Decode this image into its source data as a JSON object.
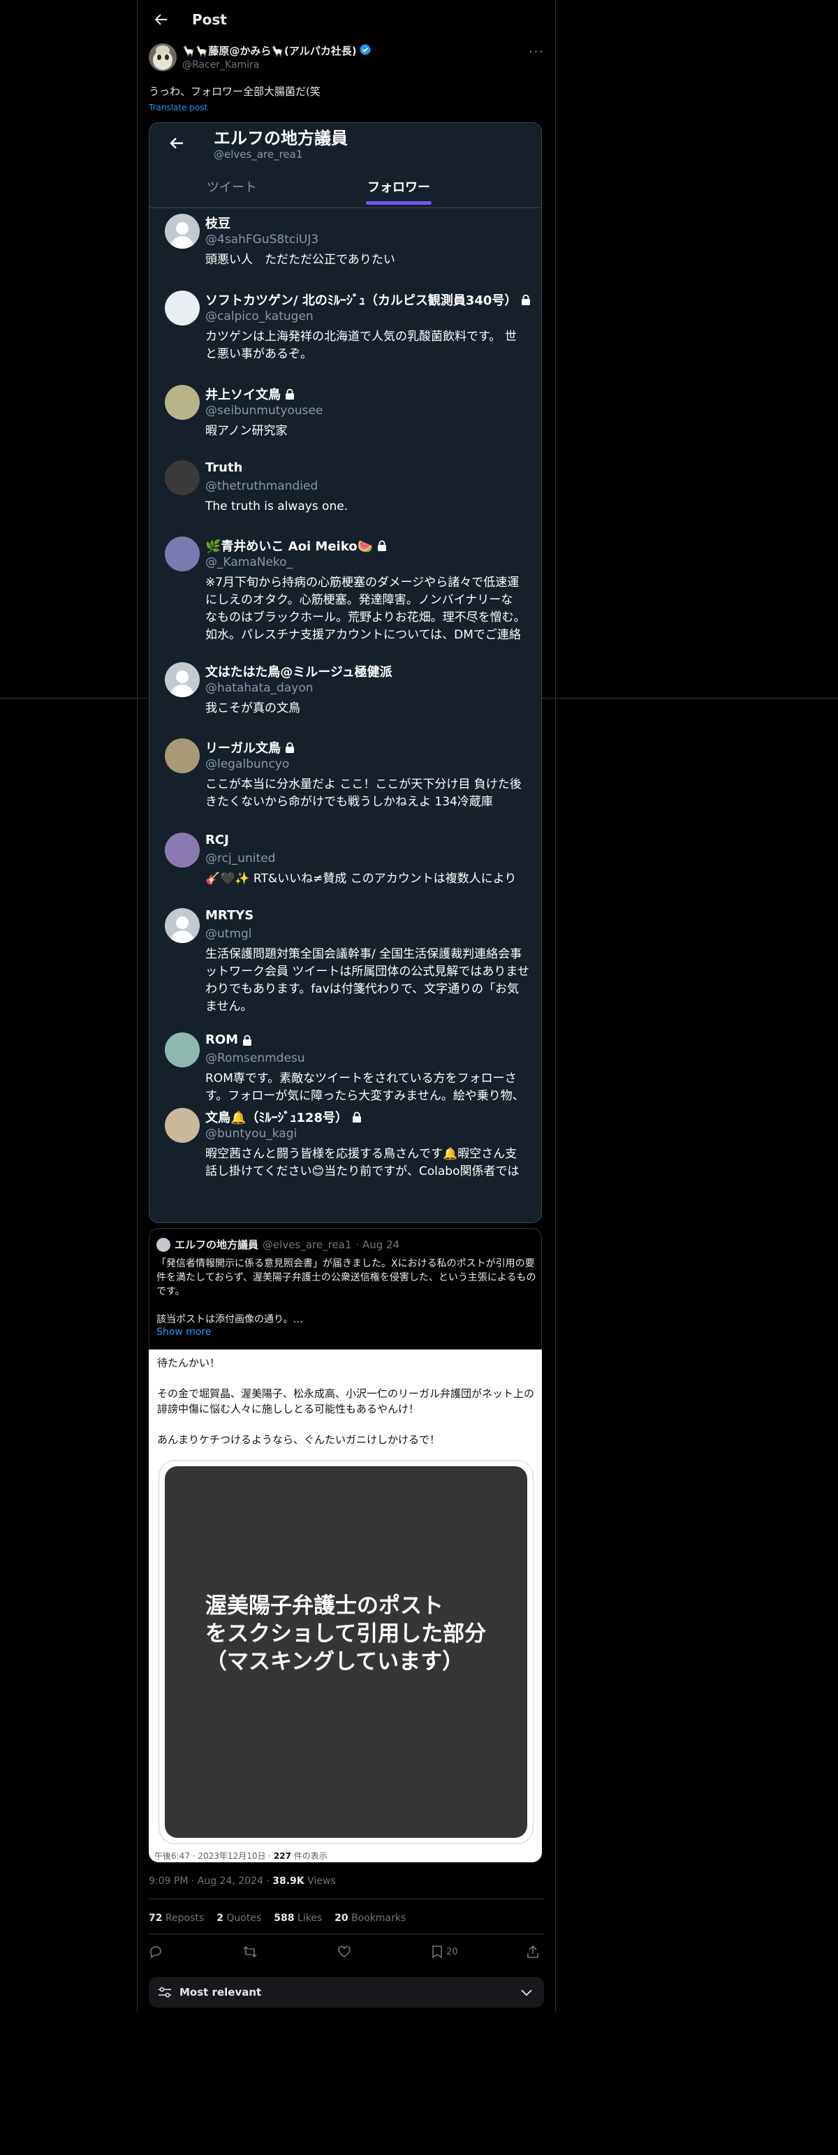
{
  "header": {
    "title": "Post"
  },
  "author": {
    "display_name": "🦙🦙藤原@かみら🦙(アルパカ社長)",
    "handle": "@Racer_Kamira"
  },
  "tweet": {
    "text": "うっわ、フォロワー全部大腸菌だ(笑",
    "translate_label": "Translate post"
  },
  "screenshot1": {
    "title": "エルフの地方議員",
    "handle": "@elves_are_rea1",
    "tabs": [
      "ツイート",
      "フォロワー"
    ],
    "users": [
      {
        "name": "枝豆",
        "handle": "@4sahFGuS8tciUJ3",
        "bio": "頭悪い人　ただただ公正でありたい",
        "locked": false,
        "avatar": "default"
      },
      {
        "name": "ソフトカツゲン/ 北のﾐﾙｰｼﾞｭ（カルピス観測員340号）",
        "handle": "@calpico_katugen",
        "bio": "カツゲンは上海発祥の北海道で人気の乳酸菌飲料です。 世\nと悪い事があるぞ。",
        "locked": true,
        "avatar": "#e8eef2"
      },
      {
        "name": "井上ソイ文鳥",
        "handle": "@seibunmutyousee",
        "bio": "暇アノン研究家",
        "locked": true,
        "avatar": "#b9b38a"
      },
      {
        "name": "Truth",
        "handle": "@thetruthmandied",
        "bio": "The truth is always one.",
        "locked": false,
        "avatar": "#3a3a3a"
      },
      {
        "name": "🌿青井めいこ Aoi Meiko🍉",
        "handle": "@_KamaNeko_",
        "bio": "※7月下旬から持病の心筋梗塞のダメージやら諸々で低速運\nにしえのオタク。心筋梗塞。発達障害。ノンバイナリーな\nなものはブラックホール。荒野よりお花畑。理不尽を憎む。\n如水。パレスチナ支援アカウントについては、DMでご連絡",
        "locked": true,
        "avatar": "#7a7ab0"
      },
      {
        "name": "文はたはた鳥@ミルージュ極健派",
        "handle": "@hatahata_dayon",
        "bio": "我こそが真の文鳥",
        "locked": false,
        "avatar": "default"
      },
      {
        "name": "リーガル文鳥",
        "handle": "@legalbuncyo",
        "bio": "ここが本当に分水量だよ ここ！ここが天下分け目 負けた後\nきたくないから命がけでも戦うしかねえよ 134冷蔵庫",
        "locked": true,
        "avatar": "#a89a78"
      },
      {
        "name": "RCJ",
        "handle": "@rcj_united",
        "bio": "🎸🖤✨ RT&いいね≠賛成 このアカウントは複数人により",
        "locked": false,
        "avatar": "#8a7ab0"
      },
      {
        "name": "MRTYS",
        "handle": "@utmgl",
        "bio": "生活保護問題対策全国会議幹事/ 全国生活保護裁判連絡会事\nットワーク会員 ツイートは所属団体の公式見解ではありませ\nわりでもあります。favは付箋代わりで、文字通りの「お気\nません。",
        "locked": false,
        "avatar": "default"
      },
      {
        "name": "ROM",
        "handle": "@Romsenmdesu",
        "bio": "ROM専です。素敵なツイートをされている方をフォローさ\nす。フォローが気に障ったら大変すみません。絵や乗り物、",
        "locked": true,
        "avatar": "#8fb8b0"
      },
      {
        "name": "文鳥🔔（ﾐﾙｰｼﾞｭ128号）",
        "handle": "@buntyou_kagi",
        "bio": "暇空茜さんと闘う皆様を応援する鳥さんです🔔暇空さん支\n話し掛けてください😊当たり前ですが、Colabo関係者では",
        "locked": true,
        "avatar": "#c9b89a"
      }
    ]
  },
  "quote": {
    "author_name": "エルフの地方議員",
    "handle": "@elves_are_rea1",
    "date": "· Aug 24",
    "text": "「発信者情報開示に係る意見照会書」が届きました。Xにおける私のポストが引用の要件を満たしておらず、渥美陽子弁護士の公衆送信権を侵害した、という主張によるものです。\n\n該当ポストは添付画像の通り。…",
    "show_more": "Show more"
  },
  "screenshot2": {
    "text": "待たんかい！\n\nその金で堀賀晶、渥美陽子、松永成高、小沢一仁のリーガル弁護団がネット上の誹謗中傷に悩む人々に施ししとる可能性もあるやんけ！\n\nあんまりケチつけるようなら、ぐんたいガニけしかけるで！",
    "image_text": "渥美陽子弁護士のポスト\nをスクショして引用した部分\n（マスキングしています）",
    "meta_date": "午後6:47 · 2023年12月10日 · ",
    "meta_views": "227",
    "meta_views_label": " 件の表示"
  },
  "timestamp": {
    "time": "9:09 PM · Aug 24, 2024 · ",
    "views": "38.9K",
    "views_label": " Views"
  },
  "stats": [
    {
      "count": "72",
      "label": " Reposts"
    },
    {
      "count": "2",
      "label": " Quotes"
    },
    {
      "count": "588",
      "label": " Likes"
    },
    {
      "count": "20",
      "label": " Bookmarks"
    }
  ],
  "actions": {
    "bookmark_count": "20"
  },
  "sort": {
    "label": "Most relevant"
  },
  "colors": {
    "accent": "#1d9bf0",
    "tab_underline": "#7856ff",
    "verified": "#1d9bf0"
  }
}
